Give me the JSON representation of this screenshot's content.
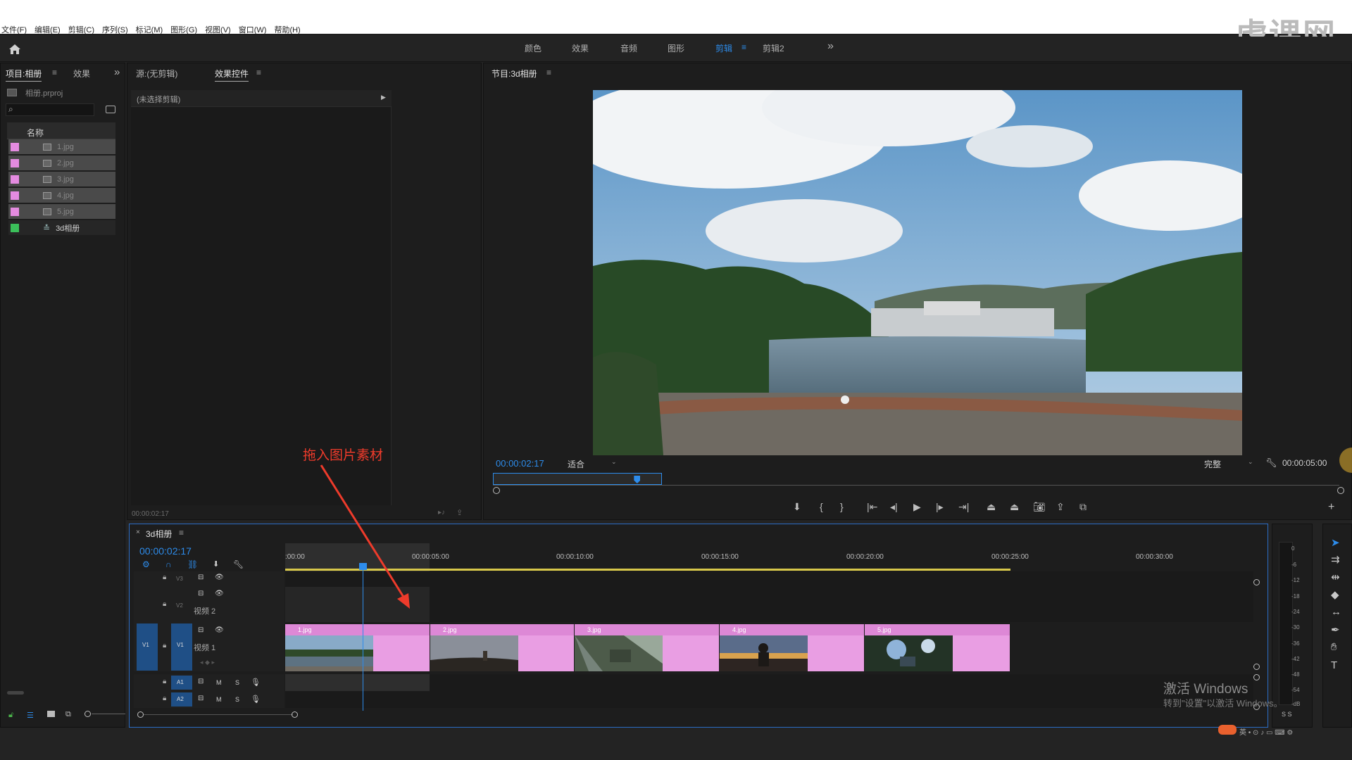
{
  "menubar": {
    "items": [
      "文件(F)",
      "编辑(E)",
      "剪辑(C)",
      "序列(S)",
      "标记(M)",
      "图形(G)",
      "视图(V)",
      "窗口(W)",
      "帮助(H)"
    ],
    "watermark": "虎课网"
  },
  "workspaces": {
    "items": [
      "颜色",
      "效果",
      "音频",
      "图形",
      "剪辑",
      "剪辑2"
    ],
    "active": "剪辑",
    "more": "»"
  },
  "project_panel": {
    "tab_project": "项目:相册",
    "tab_effects": "效果",
    "menu": "≡",
    "more": "»",
    "file": "相册.prproj",
    "column_name": "名称",
    "items": [
      {
        "name": "1.jpg",
        "color": "#e48be0"
      },
      {
        "name": "2.jpg",
        "color": "#e48be0"
      },
      {
        "name": "3.jpg",
        "color": "#e48be0"
      },
      {
        "name": "4.jpg",
        "color": "#e48be0"
      },
      {
        "name": "5.jpg",
        "color": "#e48be0"
      },
      {
        "name": "3d相册",
        "color": "#3bbf5a"
      }
    ]
  },
  "source_panel": {
    "tab_source": "源:(无剪辑)",
    "tab_effect_controls": "效果控件",
    "menu": "≡",
    "no_clip": "(未选择剪辑)",
    "timecode": "00:00:02:17"
  },
  "program_monitor": {
    "title": "节目:3d相册",
    "menu": "≡",
    "timecode": "00:00:02:17",
    "fit": "适合",
    "quality": "完整",
    "duration": "00:00:05:00",
    "playhead_fraction": 0.17
  },
  "annotation": {
    "text": "拖入图片素材",
    "color": "#ee3b2b"
  },
  "timeline": {
    "sequence_name": "3d相册",
    "menu": "≡",
    "close": "×",
    "timecode": "00:00:02:17",
    "ruler": [
      ":00:00",
      "00:00:05:00",
      "00:00:10:00",
      "00:00:15:00",
      "00:00:20:00",
      "00:00:25:00",
      "00:00:30:00"
    ],
    "tracks": {
      "v3": "V3",
      "v2": "V2",
      "v2_name": "视频 2",
      "v1_src": "V1",
      "v1": "V1",
      "v1_name": "视频 1",
      "a1": "A1",
      "a2": "A2",
      "m": "M",
      "s": "S"
    },
    "clips": [
      {
        "name": "1.jpg",
        "thumb": "lake"
      },
      {
        "name": "2.jpg",
        "thumb": "sunset"
      },
      {
        "name": "3.jpg",
        "thumb": "forest"
      },
      {
        "name": "4.jpg",
        "thumb": "person-sunset"
      },
      {
        "name": "5.jpg",
        "thumb": "trees-sky"
      }
    ]
  },
  "meter": {
    "labels": [
      "0",
      "-6",
      "-12",
      "-18",
      "-24",
      "-30",
      "-36",
      "-42",
      "-48",
      "-54",
      "-dB"
    ],
    "solo": "S S"
  },
  "windows_activation": {
    "line1": "激活 Windows",
    "line2": "转到\"设置\"以激活 Windows。"
  },
  "colors": {
    "accent": "#2d8ceb",
    "clip": "#e99ee3",
    "panel": "#1d1d1d"
  }
}
